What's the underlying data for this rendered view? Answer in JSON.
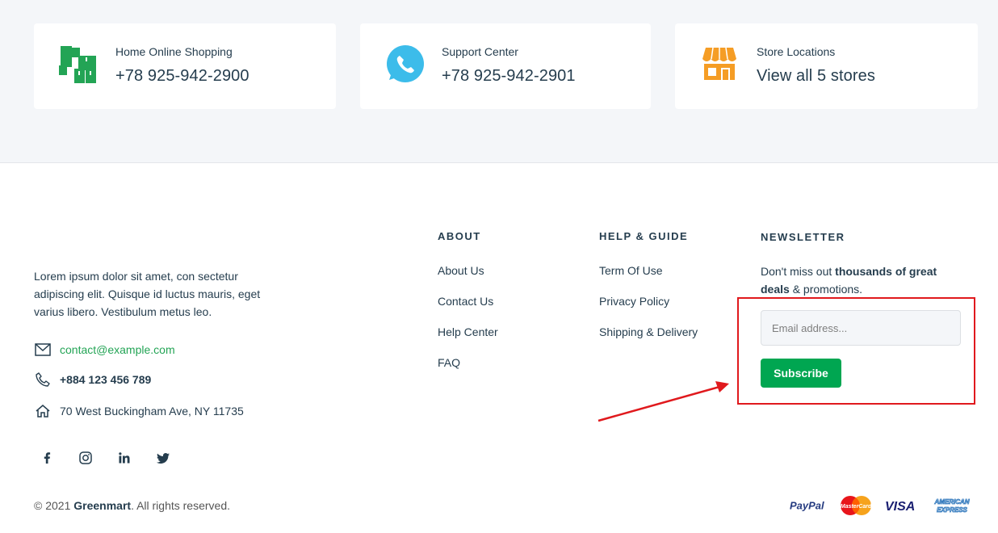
{
  "info_cards": [
    {
      "label": "Home Online Shopping",
      "value": "+78 925-942-2900",
      "icon": "boxes-icon",
      "color": "#23a455"
    },
    {
      "label": "Support Center",
      "value": "+78 925-942-2901",
      "icon": "whatsapp-phone-icon",
      "color": "#3cbcea"
    },
    {
      "label": "Store Locations",
      "value": "View all 5 stores",
      "icon": "store-icon",
      "color": "#f59d25"
    }
  ],
  "about": {
    "text": "Lorem ipsum dolor sit amet, con sectetur adipiscing elit. Quisque id luctus mauris, eget varius libero. Vestibulum metus leo.",
    "email": "contact@example.com",
    "phone": "+884 123 456 789",
    "address": "70 West Buckingham Ave, NY 11735"
  },
  "socials": [
    "facebook-icon",
    "instagram-icon",
    "linkedin-icon",
    "twitter-icon"
  ],
  "columns": {
    "about": {
      "heading": "ABOUT",
      "items": [
        "About Us",
        "Contact Us",
        "Help Center",
        "FAQ"
      ]
    },
    "help": {
      "heading": "HELP & GUIDE",
      "items": [
        "Term Of Use",
        "Privacy Policy",
        "Shipping & Delivery"
      ]
    }
  },
  "newsletter": {
    "heading": "NEWSLETTER",
    "text_pre": "Don't miss out ",
    "text_bold": "thousands of great deals",
    "text_post": " & promotions.",
    "placeholder": "Email address...",
    "button": "Subscribe"
  },
  "footer": {
    "copyright_pre": "© 2021 ",
    "brand": "Greenmart",
    "copyright_post": ". All rights reserved.",
    "payments": [
      "PayPal",
      "MasterCard",
      "VISA",
      "AMERICAN EXPRESS"
    ]
  },
  "colors": {
    "accent": "#00a651",
    "annotation": "#e0191d",
    "text": "#253D4E"
  }
}
